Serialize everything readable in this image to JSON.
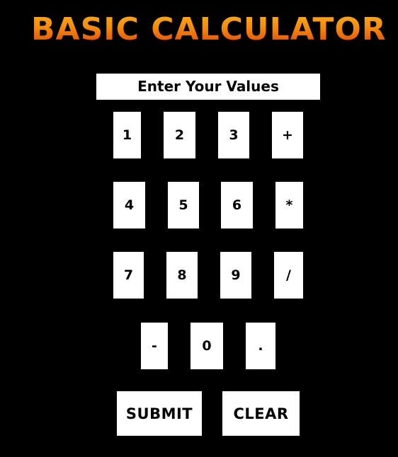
{
  "title": "BASIC CALCULATOR",
  "display": {
    "placeholder": "Enter Your Values"
  },
  "keys": {
    "k1": "1",
    "k2": "2",
    "k3": "3",
    "plus": "+",
    "k4": "4",
    "k5": "5",
    "k6": "6",
    "multiply": "*",
    "k7": "7",
    "k8": "8",
    "k9": "9",
    "divide": "/",
    "minus": "-",
    "k0": "0",
    "decimal": "."
  },
  "actions": {
    "submit": "SUBMIT",
    "clear": "CLEAR"
  },
  "colors": {
    "background": "#000000",
    "title_gradient_top": "#ffb31a",
    "title_gradient_bottom": "#e0350a",
    "button_face": "#ffffff",
    "button_text": "#000000"
  }
}
